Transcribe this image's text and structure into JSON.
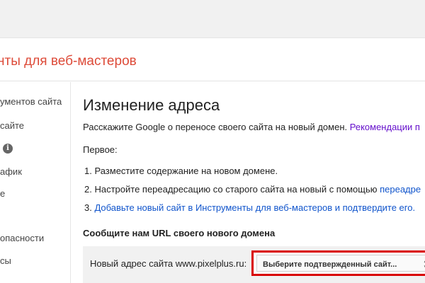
{
  "header": {
    "title": "нты для веб-мастеров"
  },
  "sidebar": {
    "items": [
      {
        "label": "ументов сайта"
      },
      {
        "label": "сайте"
      },
      {
        "label": "афик"
      },
      {
        "label": "е"
      },
      {
        "label": "опасности"
      },
      {
        "label": "сы"
      }
    ],
    "info_icon": "i"
  },
  "main": {
    "title": "Изменение адреса",
    "intro_text": "Расскажите Google о переносе своего сайта на новый домен.",
    "intro_link": "Рекомендации п",
    "first_label": "Первое:",
    "steps": [
      {
        "number": "1.",
        "text": "Разместите содержание на новом домене."
      },
      {
        "number": "2.",
        "text": "Настройте переадресацию со старого сайта на новый с помощью",
        "link": "переадре"
      },
      {
        "number": "3.",
        "link": "Добавьте новый сайт в Инструменты для веб-мастеров и подтвердите его."
      }
    ],
    "section_heading": "Сообщите нам URL своего нового домена",
    "form": {
      "label": "Новый адрес сайта www.pixelplus.ru:",
      "select_value": "Выберите подтвержденный сайт...",
      "arrows": "▲▼"
    }
  },
  "colors": {
    "title_red": "#dd4b39",
    "link_blue": "#1155cc",
    "link_visited": "#6611cc",
    "highlight_red": "#d90000"
  }
}
